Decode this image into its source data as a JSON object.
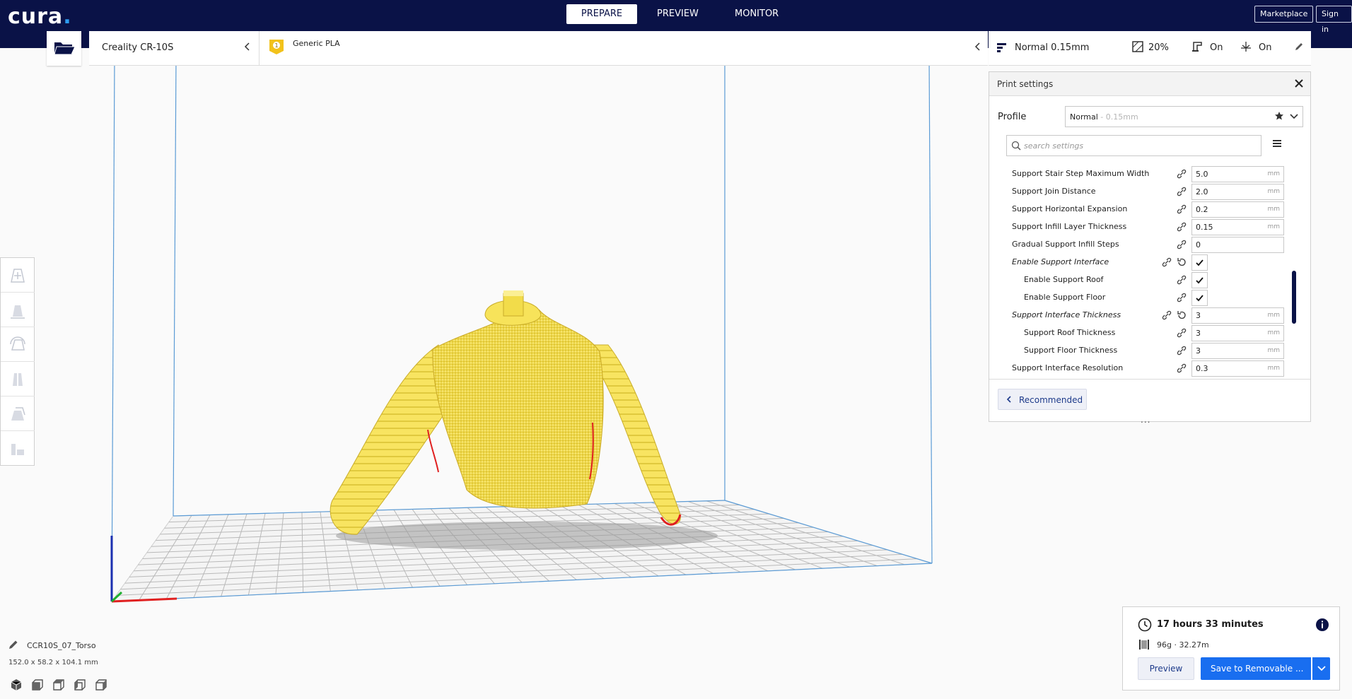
{
  "app": {
    "logo": "cura",
    "logo_dot": "."
  },
  "stages": {
    "prepare": "PREPARE",
    "preview": "PREVIEW",
    "monitor": "MONITOR"
  },
  "topbar": {
    "marketplace": "Marketplace",
    "sign_in": "Sign in"
  },
  "printer": {
    "name": "Creality CR-10S",
    "extruder_number": "1",
    "material": "Generic PLA"
  },
  "settings_summary": {
    "profile": "Normal 0.15mm",
    "infill": "20%",
    "support": "On",
    "adhesion": "On"
  },
  "print_settings": {
    "title": "Print settings",
    "profile_label": "Profile",
    "profile_name": "Normal",
    "profile_layer": " - 0.15mm",
    "search_placeholder": "search settings",
    "rows": [
      {
        "label": "Support Stair Step Maximum Width",
        "value": "5.0",
        "unit": "mm"
      },
      {
        "label": "Support Join Distance",
        "value": "2.0",
        "unit": "mm"
      },
      {
        "label": "Support Horizontal Expansion",
        "value": "0.2",
        "unit": "mm"
      },
      {
        "label": "Support Infill Layer Thickness",
        "value": "0.15",
        "unit": "mm"
      },
      {
        "label": "Gradual Support Infill Steps",
        "value": "0",
        "unit": ""
      },
      {
        "label": "Enable Support Interface",
        "checked": true
      },
      {
        "label": "Enable Support Roof",
        "checked": true
      },
      {
        "label": "Enable Support Floor",
        "checked": true
      },
      {
        "label": "Support Interface Thickness",
        "value": "3",
        "unit": "mm"
      },
      {
        "label": "Support Roof Thickness",
        "value": "3",
        "unit": "mm"
      },
      {
        "label": "Support Floor Thickness",
        "value": "3",
        "unit": "mm"
      },
      {
        "label": "Support Interface Resolution",
        "value": "0.3",
        "unit": "mm"
      }
    ],
    "recommended": "Recommended",
    "grip": "..."
  },
  "object": {
    "name": "CCR10S_07_Torso",
    "dimensions": "152.0 x 58.2 x 104.1 mm"
  },
  "job": {
    "print_time": "17 hours 33 minutes",
    "material_usage": "96g · 32.27m",
    "preview": "Preview",
    "save": "Save to Removable ..."
  },
  "colors": {
    "navy": "#0a1247",
    "accent_blue": "#196ef0",
    "model_yellow": "#f7e35a",
    "build_volume_line": "#5b9bd5"
  }
}
